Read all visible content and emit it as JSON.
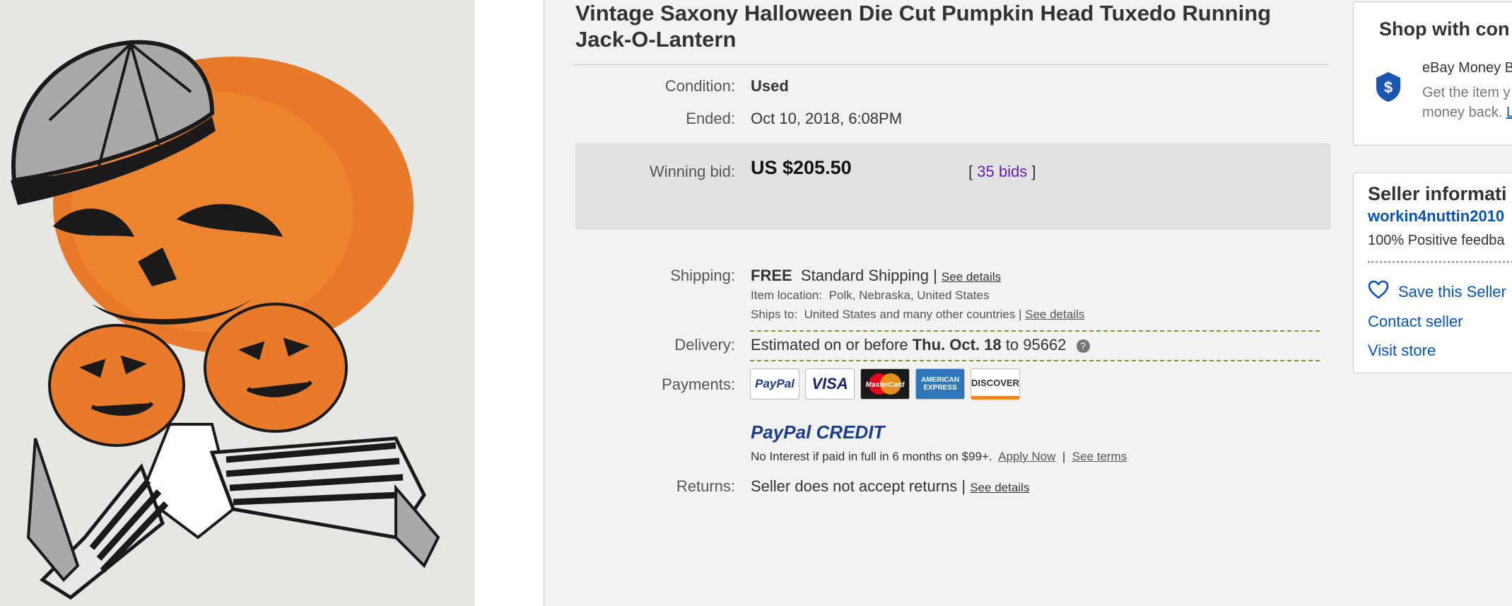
{
  "listing": {
    "title": "Vintage Saxony Halloween Die Cut Pumpkin Head Tuxedo Running Jack-O-Lantern",
    "condition_label": "Condition:",
    "condition_value": "Used",
    "ended_label": "Ended:",
    "ended_value": "Oct 10, 2018",
    "ended_time": ", 6:08PM",
    "winning_bid_label": "Winning bid:",
    "winning_bid_value": "US $205.50",
    "bids_open": "[",
    "bids_count": "35 bids",
    "bids_close": "]"
  },
  "shipping": {
    "label": "Shipping:",
    "free": "FREE",
    "method": "Standard Shipping",
    "sep": "|",
    "see_details": "See details",
    "item_location_label": "Item location:",
    "item_location": "Polk, Nebraska, United States",
    "ships_to_label": "Ships to:",
    "ships_to": "United States and many other countries",
    "ships_sep": "|",
    "ships_see_details": "See details"
  },
  "delivery": {
    "label": "Delivery:",
    "prefix": "Estimated on or before",
    "date": "Thu. Oct. 18",
    "to": "to",
    "zip": "95662",
    "help_icon": "?"
  },
  "payments": {
    "label": "Payments:",
    "logos": [
      "PayPal",
      "VISA",
      "MasterCard",
      "AMERICAN EXPRESS",
      "DISCOVER"
    ],
    "credit_logo_a": "PayPal",
    "credit_logo_b": "CREDIT",
    "credit_text": "No Interest if paid in full in 6 months on $99+.",
    "apply_now": "Apply Now",
    "sep": "|",
    "see_terms": "See terms"
  },
  "returns": {
    "label": "Returns:",
    "value": "Seller does not accept returns",
    "sep": "|",
    "see_details": "See details"
  },
  "shop_confidence": {
    "title": "Shop with con",
    "guarantee_title": "eBay Money B",
    "guarantee_line1": "Get the item y",
    "guarantee_line2": "money back.",
    "learn_more": "L"
  },
  "seller": {
    "title": "Seller informati",
    "username": "workin4nuttin2010",
    "feedback": "100% Positive feedba",
    "save_seller": "Save this Seller",
    "contact": "Contact seller",
    "visit_store": "Visit store"
  },
  "colors": {
    "link_blue": "#0654ba",
    "bids_purple": "#5f1fa8",
    "pumpkin_orange": "#e87a2a",
    "guarantee_blue": "#1a56b0"
  }
}
